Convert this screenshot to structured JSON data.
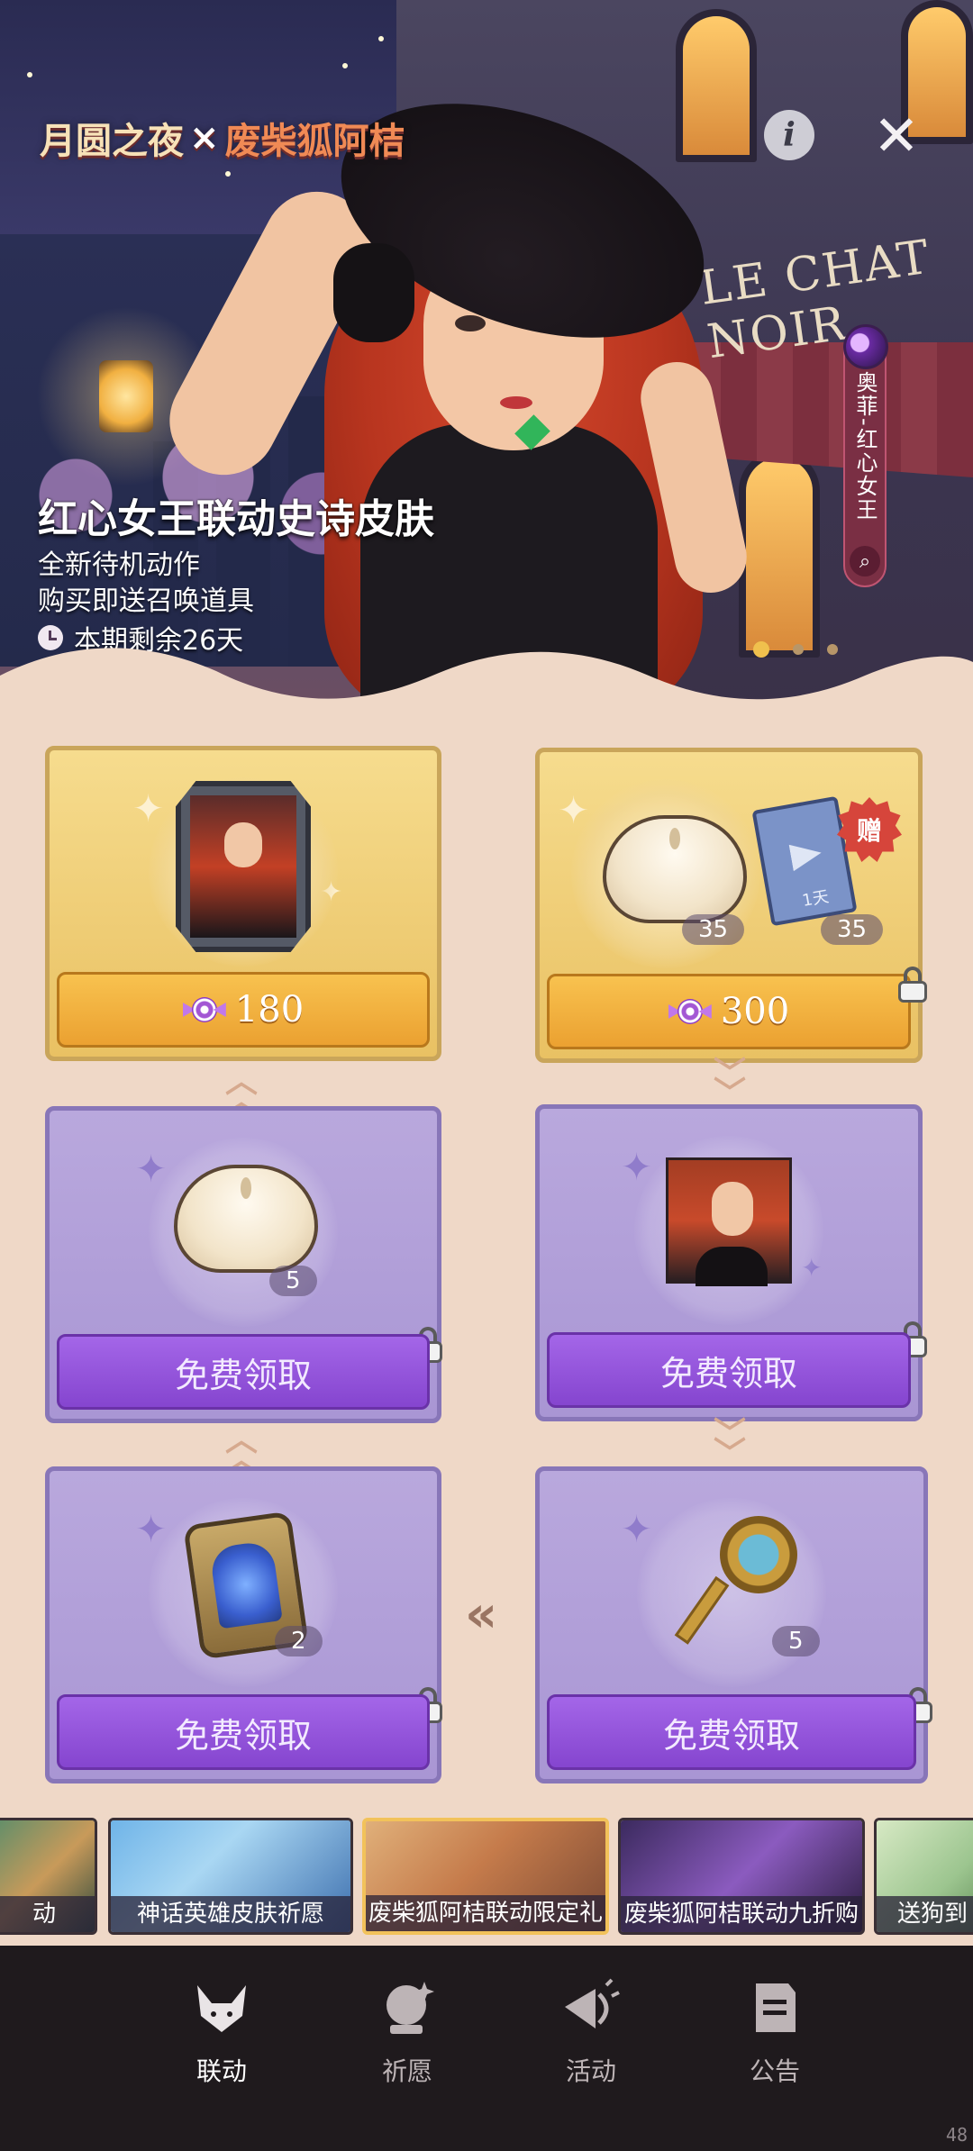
{
  "banner": {
    "logo": {
      "part1": "月圆之夜",
      "x": "×",
      "part2": "废柴狐阿桔"
    },
    "skin_title": "红心女王联动史诗皮肤",
    "desc_lines": [
      "全新待机动作",
      "购买即送召唤道具"
    ],
    "remaining": "本期剩余26天",
    "shop_sign": "LE CHAT NOIR",
    "character_tag": "奥菲-红心女王",
    "carousel_pages": 3,
    "carousel_active_index": 0
  },
  "cards": {
    "top_left": {
      "price": "180",
      "currency_icon": "candy-icon"
    },
    "top_right": {
      "price": "300",
      "currency_icon": "candy-icon",
      "bun_count": "35",
      "ticket_count": "35",
      "ticket_days": "1天",
      "gift_label": "赠"
    },
    "mid_left": {
      "button": "免费领取",
      "count": "5"
    },
    "mid_right": {
      "button": "免费领取"
    },
    "bottom_left": {
      "button": "免费领取",
      "count": "2"
    },
    "bottom_right": {
      "button": "免费领取",
      "count": "5"
    }
  },
  "events": [
    {
      "label": "动"
    },
    {
      "label": "神话英雄皮肤祈愿"
    },
    {
      "label": "废柴狐阿桔联动限定礼"
    },
    {
      "label": "废柴狐阿桔联动九折购"
    },
    {
      "label": "送狗到"
    }
  ],
  "nav": [
    {
      "label": "联动",
      "icon": "fox-icon",
      "active": true
    },
    {
      "label": "祈愿",
      "icon": "crystal-ball-icon",
      "active": false
    },
    {
      "label": "活动",
      "icon": "megaphone-icon",
      "active": false
    },
    {
      "label": "公告",
      "icon": "notice-icon",
      "active": false
    }
  ],
  "fps": "48",
  "colors": {
    "gold_button": "#eba131",
    "purple_button": "#8545cf",
    "panel_bg": "#efd8c7",
    "nav_bg": "#1f1a1d"
  }
}
